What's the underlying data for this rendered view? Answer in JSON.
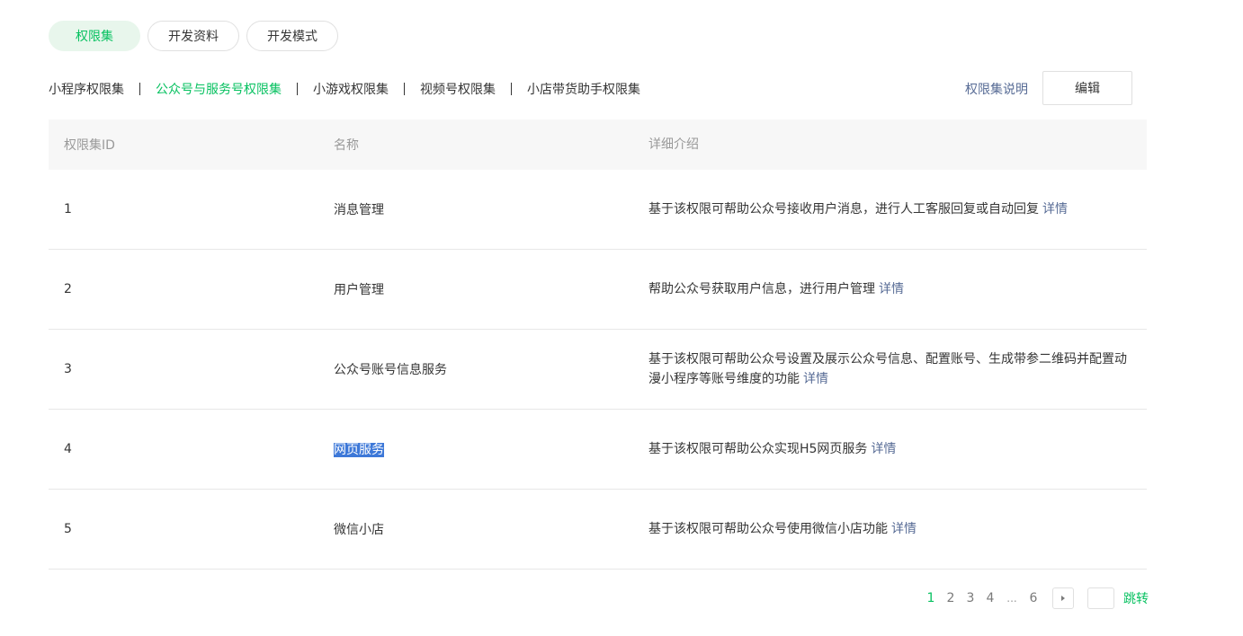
{
  "top_tabs": [
    {
      "label": "权限集",
      "active": true
    },
    {
      "label": "开发资料",
      "active": false
    },
    {
      "label": "开发模式",
      "active": false
    }
  ],
  "sub_tabs": [
    {
      "label": "小程序权限集",
      "active": false
    },
    {
      "label": "公众号与服务号权限集",
      "active": true
    },
    {
      "label": "小游戏权限集",
      "active": false
    },
    {
      "label": "视频号权限集",
      "active": false
    },
    {
      "label": "小店带货助手权限集",
      "active": false
    }
  ],
  "toolbar": {
    "explain_label": "权限集说明",
    "edit_label": "编辑"
  },
  "table": {
    "columns": [
      "权限集ID",
      "名称",
      "详细介绍"
    ],
    "detail_label": "详情",
    "rows": [
      {
        "id": "1",
        "name": "消息管理",
        "desc": "基于该权限可帮助公众号接收用户消息，进行人工客服回复或自动回复"
      },
      {
        "id": "2",
        "name": "用户管理",
        "desc": "帮助公众号获取用户信息，进行用户管理"
      },
      {
        "id": "3",
        "name": "公众号账号信息服务",
        "desc": "基于该权限可帮助公众号设置及展示公众号信息、配置账号、生成带参二维码并配置动漫小程序等账号维度的功能"
      },
      {
        "id": "4",
        "name": "网页服务",
        "desc": "基于该权限可帮助公众实现H5网页服务"
      },
      {
        "id": "5",
        "name": "微信小店",
        "desc": "基于该权限可帮助公众号使用微信小店功能"
      }
    ]
  },
  "pagination": {
    "pages": [
      "1",
      "2",
      "3",
      "4"
    ],
    "ellipsis": "...",
    "last_page": "6",
    "current": "1",
    "jump_label": "跳转",
    "jump_value": ""
  },
  "colors": {
    "accent": "#07c160",
    "link": "#576b95",
    "selection": "#3d78d8"
  }
}
